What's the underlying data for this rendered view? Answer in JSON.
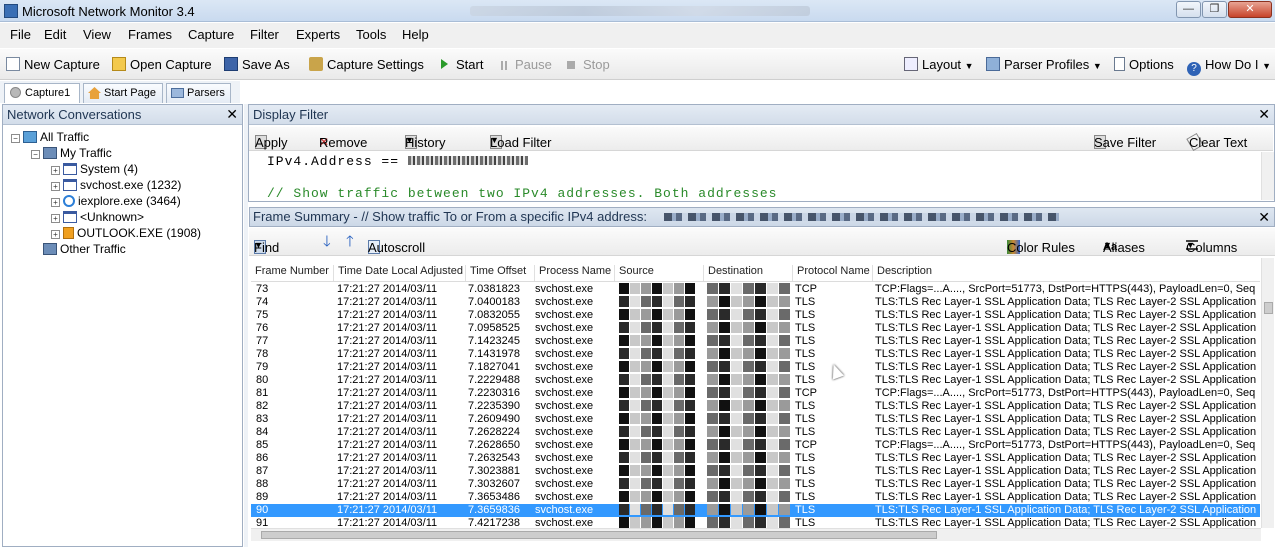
{
  "window": {
    "title": "Microsoft Network Monitor 3.4",
    "min_glyph": "—",
    "max_glyph": "❐",
    "close_glyph": "✕"
  },
  "menu": [
    "File",
    "Edit",
    "View",
    "Frames",
    "Capture",
    "Filter",
    "Experts",
    "Tools",
    "Help"
  ],
  "toolbar": {
    "new_capture": "New Capture",
    "open_capture": "Open Capture",
    "save_as": "Save As",
    "capture_settings": "Capture Settings",
    "start": "Start",
    "pause": "Pause",
    "stop": "Stop",
    "layout": "Layout",
    "parser_profiles": "Parser Profiles",
    "options": "Options",
    "how_do_i": "How Do I"
  },
  "tabs": [
    "Capture1",
    "Start Page",
    "Parsers"
  ],
  "conversations": {
    "title": "Network Conversations",
    "close": "✕",
    "items": [
      {
        "label": "All Traffic",
        "expander": "−"
      },
      {
        "label": "My Traffic",
        "expander": "−"
      },
      {
        "label": "System (4)",
        "expander": "+"
      },
      {
        "label": "svchost.exe (1232)",
        "expander": "+"
      },
      {
        "label": "iexplore.exe (3464)",
        "expander": "+"
      },
      {
        "label": "<Unknown>",
        "expander": "+"
      },
      {
        "label": "OUTLOOK.EXE (1908)",
        "expander": "+"
      },
      {
        "label": "Other Traffic",
        "expander": ""
      }
    ]
  },
  "display_filter": {
    "title": "Display Filter",
    "close": "✕",
    "apply": "Apply",
    "remove": "Remove",
    "history": "History",
    "load_filter": "Load Filter",
    "save_filter": "Save Filter",
    "clear_text": "Clear Text",
    "line1": "IPv4.Address == ",
    "line2": "// Show traffic between two IPv4 addresses.  Both addresses"
  },
  "frame_summary": {
    "title": "Frame Summary - // Show traffic To or From a specific IPv4 address:",
    "close": "✕",
    "find": "Find",
    "autoscroll": "Autoscroll",
    "color_rules": "Color Rules",
    "aliases": "Aliases",
    "columns": "Columns",
    "headers": [
      "Frame Number",
      "Time Date Local Adjusted",
      "Time Offset",
      "Process Name",
      "Source",
      "Destination",
      "Protocol Name",
      "Description"
    ],
    "rows": [
      {
        "n": "73",
        "t": "17:21:27 2014/03/11",
        "o": "7.0381823",
        "p": "svchost.exe",
        "proto": "TCP",
        "d": "TCP:Flags=...A...., SrcPort=51773, DstPort=HTTPS(443), PayloadLen=0, Seq"
      },
      {
        "n": "74",
        "t": "17:21:27 2014/03/11",
        "o": "7.0400183",
        "p": "svchost.exe",
        "proto": "TLS",
        "d": "TLS:TLS Rec Layer-1 SSL Application Data; TLS Rec Layer-2 SSL Application Dat"
      },
      {
        "n": "75",
        "t": "17:21:27 2014/03/11",
        "o": "7.0832055",
        "p": "svchost.exe",
        "proto": "TLS",
        "d": "TLS:TLS Rec Layer-1 SSL Application Data; TLS Rec Layer-2 SSL Application Dat"
      },
      {
        "n": "76",
        "t": "17:21:27 2014/03/11",
        "o": "7.0958525",
        "p": "svchost.exe",
        "proto": "TLS",
        "d": "TLS:TLS Rec Layer-1 SSL Application Data; TLS Rec Layer-2 SSL Application Dat"
      },
      {
        "n": "77",
        "t": "17:21:27 2014/03/11",
        "o": "7.1423245",
        "p": "svchost.exe",
        "proto": "TLS",
        "d": "TLS:TLS Rec Layer-1 SSL Application Data; TLS Rec Layer-2 SSL Application Dat"
      },
      {
        "n": "78",
        "t": "17:21:27 2014/03/11",
        "o": "7.1431978",
        "p": "svchost.exe",
        "proto": "TLS",
        "d": "TLS:TLS Rec Layer-1 SSL Application Data; TLS Rec Layer-2 SSL Application Dat"
      },
      {
        "n": "79",
        "t": "17:21:27 2014/03/11",
        "o": "7.1827041",
        "p": "svchost.exe",
        "proto": "TLS",
        "d": "TLS:TLS Rec Layer-1 SSL Application Data; TLS Rec Layer-2 SSL Application Dat"
      },
      {
        "n": "80",
        "t": "17:21:27 2014/03/11",
        "o": "7.2229488",
        "p": "svchost.exe",
        "proto": "TLS",
        "d": "TLS:TLS Rec Layer-1 SSL Application Data; TLS Rec Layer-2 SSL Application Dat"
      },
      {
        "n": "81",
        "t": "17:21:27 2014/03/11",
        "o": "7.2230316",
        "p": "svchost.exe",
        "proto": "TCP",
        "d": "TCP:Flags=...A...., SrcPort=51773, DstPort=HTTPS(443), PayloadLen=0, Seq"
      },
      {
        "n": "82",
        "t": "17:21:27 2014/03/11",
        "o": "7.2235390",
        "p": "svchost.exe",
        "proto": "TLS",
        "d": "TLS:TLS Rec Layer-1 SSL Application Data; TLS Rec Layer-2 SSL Application Dat"
      },
      {
        "n": "83",
        "t": "17:21:27 2014/03/11",
        "o": "7.2609490",
        "p": "svchost.exe",
        "proto": "TLS",
        "d": "TLS:TLS Rec Layer-1 SSL Application Data; TLS Rec Layer-2 SSL Application Dat"
      },
      {
        "n": "84",
        "t": "17:21:27 2014/03/11",
        "o": "7.2628224",
        "p": "svchost.exe",
        "proto": "TLS",
        "d": "TLS:TLS Rec Layer-1 SSL Application Data; TLS Rec Layer-2 SSL Application Dat"
      },
      {
        "n": "85",
        "t": "17:21:27 2014/03/11",
        "o": "7.2628650",
        "p": "svchost.exe",
        "proto": "TCP",
        "d": "TCP:Flags=...A...., SrcPort=51773, DstPort=HTTPS(443), PayloadLen=0, Seq"
      },
      {
        "n": "86",
        "t": "17:21:27 2014/03/11",
        "o": "7.2632543",
        "p": "svchost.exe",
        "proto": "TLS",
        "d": "TLS:TLS Rec Layer-1 SSL Application Data; TLS Rec Layer-2 SSL Application Dat"
      },
      {
        "n": "87",
        "t": "17:21:27 2014/03/11",
        "o": "7.3023881",
        "p": "svchost.exe",
        "proto": "TLS",
        "d": "TLS:TLS Rec Layer-1 SSL Application Data; TLS Rec Layer-2 SSL Application Dat"
      },
      {
        "n": "88",
        "t": "17:21:27 2014/03/11",
        "o": "7.3032607",
        "p": "svchost.exe",
        "proto": "TLS",
        "d": "TLS:TLS Rec Layer-1 SSL Application Data; TLS Rec Layer-2 SSL Application Dat"
      },
      {
        "n": "89",
        "t": "17:21:27 2014/03/11",
        "o": "7.3653486",
        "p": "svchost.exe",
        "proto": "TLS",
        "d": "TLS:TLS Rec Layer-1 SSL Application Data; TLS Rec Layer-2 SSL Application Dat"
      },
      {
        "n": "90",
        "t": "17:21:27 2014/03/11",
        "o": "7.3659836",
        "p": "svchost.exe",
        "proto": "TLS",
        "d": "TLS:TLS Rec Layer-1 SSL Application Data; TLS Rec Layer-2 SSL Application Dat"
      },
      {
        "n": "91",
        "t": "17:21:27 2014/03/11",
        "o": "7.4217238",
        "p": "svchost.exe",
        "proto": "TLS",
        "d": "TLS:TLS Rec Layer-1 SSL Application Data; TLS Rec Layer-2 SSL Application Dat"
      }
    ],
    "selected_frame": "90"
  },
  "colors": {
    "selection": "#3399ff",
    "panel_header": "#d3ddea",
    "filter_comment": "#2a8a2a"
  }
}
